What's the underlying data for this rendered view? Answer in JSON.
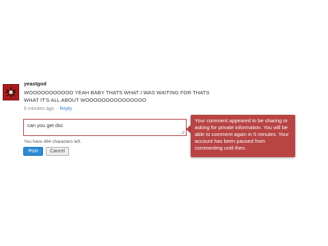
{
  "comment": {
    "username": "yeastgod",
    "text": "WOOOOOOOOOOO YEAH BABY THATS WHAT I WAS WAITING FOR THATS WHAT IT'S ALL ABOUT WOOOOOOOOOOOOOOO",
    "time_ago": "6 minutes ago",
    "separator": "·",
    "reply_label": "Reply"
  },
  "reply_form": {
    "value": "can you get dsc",
    "chars_left": "You have 484 characters left.",
    "post_label": "Post",
    "cancel_label": "Cancel"
  },
  "tooltip": {
    "message": "Your comment appeared to be sharing or asking for private information. You will be able to comment again in 5 minutes. Your account has been paused from commenting until then.",
    "color": "#b84444"
  },
  "colors": {
    "accent": "#2d8bd6",
    "error_border": "#b23a3a"
  }
}
